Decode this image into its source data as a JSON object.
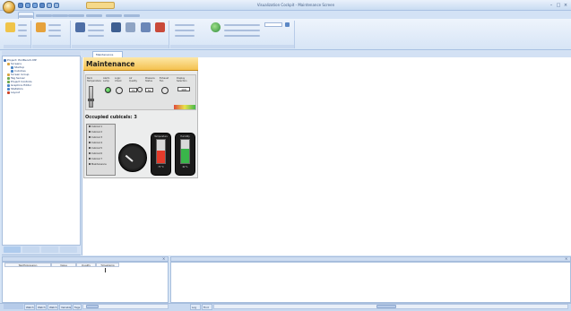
{
  "window": {
    "title": "Visualization Cockpit - Maintenance Screen",
    "context_tab": "Graphic Tools",
    "controls": [
      "–",
      "□",
      "×"
    ]
  },
  "ribbon": {
    "tabs": [
      "Home",
      "View",
      "Insert",
      "Arrange",
      "Animation",
      "Graphics",
      "Tools"
    ],
    "active_tab_index": 0,
    "groups": [
      "Clipboard",
      "Screen Management",
      "Format",
      "Tools"
    ]
  },
  "project_tree": {
    "items": [
      {
        "label": "Project: PLCBench-MP",
        "level": 0,
        "color": "#3d6fb6"
      },
      {
        "label": "Screens",
        "level": 1,
        "color": "#d9a441"
      },
      {
        "label": "Startup",
        "level": 2,
        "color": "#4a86c8"
      },
      {
        "label": "Cubicles",
        "level": 2,
        "color": "#4a86c8"
      },
      {
        "label": "Screen Group",
        "level": 1,
        "color": "#d9a441"
      },
      {
        "label": "Tag Server",
        "level": 1,
        "color": "#6aa84f"
      },
      {
        "label": "Project Controls",
        "level": 1,
        "color": "#6aa84f"
      },
      {
        "label": "Graphics Editor",
        "level": 1,
        "color": "#4a86c8"
      },
      {
        "label": "Statistics",
        "level": 1,
        "color": "#4a86c8"
      },
      {
        "label": "Layout",
        "level": 1,
        "color": "#cc4125"
      }
    ],
    "bottom_tabs": [
      "Views",
      "Servers",
      "Data",
      "Links"
    ]
  },
  "document": {
    "tab_label": "Maintenance"
  },
  "hmi": {
    "title": "Maintenance",
    "controls": [
      {
        "label": "Rack Temperature"
      },
      {
        "label": "Alarm Lamp"
      },
      {
        "label": "Logic Check"
      },
      {
        "label": "Air Quality"
      },
      {
        "label": "Pressure Status"
      },
      {
        "label": "Exhaust Fan"
      },
      {
        "label": "Display Selection"
      }
    ],
    "quality_value": "75",
    "pressure_value": "50",
    "display_value": "100",
    "occupied_label": "Occupied cubicals: 3",
    "cubicles": [
      "Cubical 1",
      "Cubical 2",
      "Cubical 3",
      "Cubical 4",
      "Cubical 5",
      "Cubical 6",
      "Cubical 7",
      "Maintenance"
    ],
    "meter_left": {
      "label": "Temperature",
      "value_text": "75 °C",
      "level": 0.55,
      "color": "#e33b2b"
    },
    "meter_right": {
      "label": "Humidity",
      "value_text": "62 %",
      "level": 0.62,
      "color": "#39b54a"
    }
  },
  "bottom_left": {
    "columns": [
      "Tag/Expression",
      "Value",
      "Quality",
      "Timestamp"
    ]
  },
  "status_tabs_left": [
    "Watch 1",
    "Watch 2",
    "Watch 3",
    "Variables",
    "Tags"
  ],
  "status_tabs_right": [
    "Log",
    "Find"
  ]
}
